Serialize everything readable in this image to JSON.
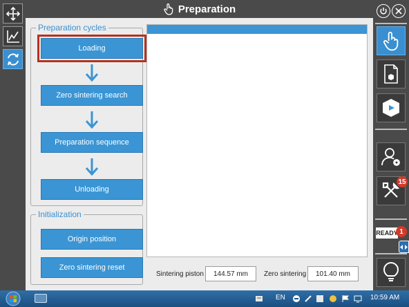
{
  "window": {
    "title": "Preparation"
  },
  "left_toolbar": [
    {
      "icon": "move-arrows-icon",
      "active": false
    },
    {
      "icon": "chart-line-icon",
      "active": false
    },
    {
      "icon": "refresh-cycle-icon",
      "active": true
    }
  ],
  "preparation_cycles": {
    "title": "Preparation cycles",
    "buttons": [
      "Loading",
      "Zero sintering search",
      "Preparation sequence",
      "Unloading"
    ],
    "selected": "Loading"
  },
  "initialization": {
    "title": "Initialization",
    "buttons": [
      "Origin position",
      "Zero sintering reset"
    ]
  },
  "readouts": {
    "sintering_piston": {
      "label": "Sintering piston",
      "value": "144.57 mm"
    },
    "zero_sintering": {
      "label": "Zero sintering",
      "value": "101.40 mm"
    }
  },
  "right_toolbar": {
    "top_controls": [
      "power-icon",
      "close-icon"
    ],
    "buttons": [
      "touch-hand-icon",
      "document-cube-icon",
      "play-cube-icon",
      "user-settings-icon",
      "tools-icon",
      "lightbulb-icon"
    ],
    "tools_badge": "15",
    "status_label": "READY",
    "status_badge": "1"
  },
  "taskbar": {
    "language": "EN",
    "clock": "10:59 AM",
    "accent": "#1b4f82"
  },
  "colors": {
    "accent": "#3b95d4",
    "selection": "#b8301e",
    "background": "#ececec"
  }
}
